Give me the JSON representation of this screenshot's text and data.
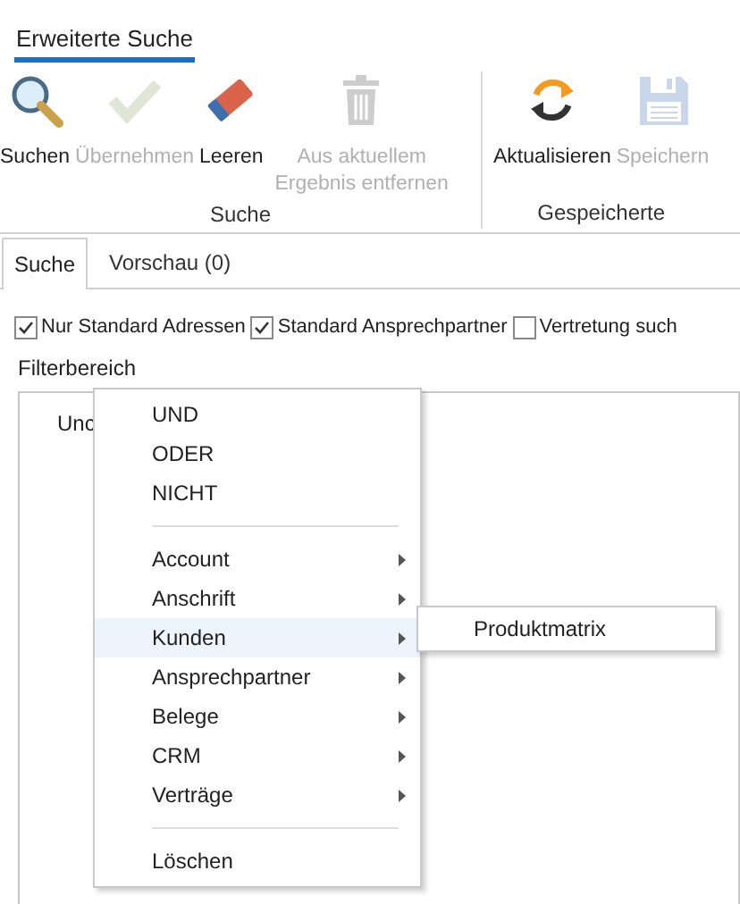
{
  "ribbon": {
    "tab": {
      "label": "Erweiterte Suche",
      "selected": true
    },
    "groups": [
      {
        "label": "Suche",
        "buttons": [
          {
            "kind": "search",
            "label": "Suchen",
            "disabled": false
          },
          {
            "kind": "apply",
            "label": "Übernehmen",
            "disabled": true
          },
          {
            "kind": "clear",
            "label": "Leeren",
            "disabled": false
          },
          {
            "kind": "delete",
            "label": "Aus aktuellem Ergebnis entfernen",
            "disabled": true
          }
        ]
      },
      {
        "label": "Gespeicherte",
        "buttons": [
          {
            "kind": "refresh",
            "label": "Aktualisieren",
            "disabled": false
          },
          {
            "kind": "save",
            "label": "Speichern",
            "disabled": true
          }
        ]
      }
    ]
  },
  "tabs": [
    {
      "label": "Suche",
      "selected": true
    },
    {
      "label": "Vorschau (0)",
      "selected": false
    }
  ],
  "options": [
    {
      "label": "Nur Standard Adressen",
      "checked": true
    },
    {
      "label": "Standard Ansprechpartner",
      "checked": true
    },
    {
      "label": "Vertretung such",
      "checked": false
    }
  ],
  "filter": {
    "label": "Filterbereich",
    "node": "Unc"
  },
  "context_menu": {
    "items": [
      {
        "kind": "item",
        "label": "UND",
        "highlighted": false
      },
      {
        "kind": "item",
        "label": "ODER",
        "highlighted": false
      },
      {
        "kind": "item",
        "label": "NICHT",
        "highlighted": false
      },
      {
        "kind": "separator"
      },
      {
        "kind": "submenu",
        "label": "Account",
        "highlighted": false
      },
      {
        "kind": "submenu",
        "label": "Anschrift",
        "highlighted": false
      },
      {
        "kind": "submenu",
        "label": "Kunden",
        "highlighted": true
      },
      {
        "kind": "submenu",
        "label": "Ansprechpartner",
        "highlighted": false
      },
      {
        "kind": "submenu",
        "label": "Belege",
        "highlighted": false
      },
      {
        "kind": "submenu",
        "label": "CRM",
        "highlighted": false
      },
      {
        "kind": "submenu",
        "label": "Verträge",
        "highlighted": false
      },
      {
        "kind": "separator"
      },
      {
        "kind": "item",
        "label": "Löschen",
        "highlighted": false
      }
    ]
  },
  "submenu": {
    "items": [
      {
        "label": "Produktmatrix"
      }
    ]
  }
}
